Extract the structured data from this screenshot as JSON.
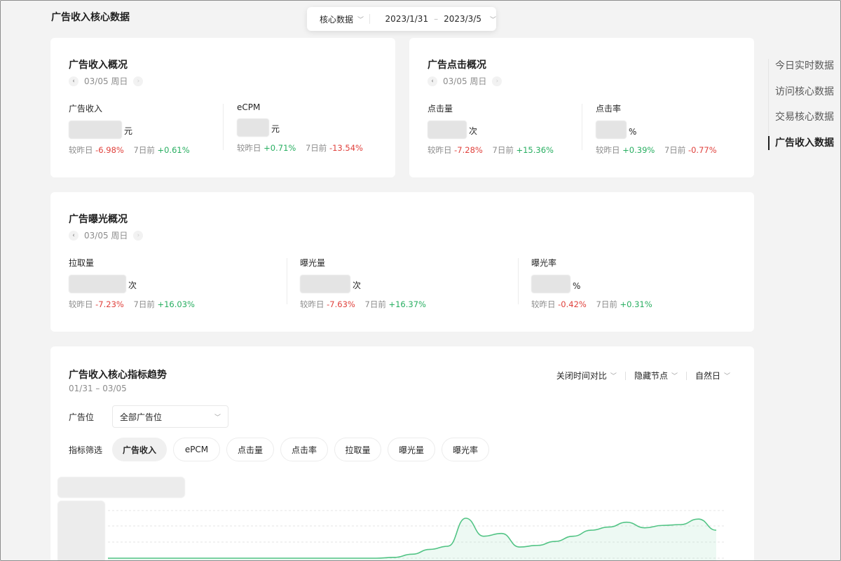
{
  "page_title": "广告收入核心数据",
  "filter_bar": {
    "scope": "核心数据",
    "date_start": "2023/1/31",
    "date_sep": "–",
    "date_end": "2023/3/5"
  },
  "side_nav": {
    "items": [
      {
        "label": "今日实时数据",
        "active": false
      },
      {
        "label": "访问核心数据",
        "active": false
      },
      {
        "label": "交易核心数据",
        "active": false
      },
      {
        "label": "广告收入数据",
        "active": true
      }
    ]
  },
  "revenue_card": {
    "title": "广告收入概况",
    "date": "03/05 周日",
    "metrics": [
      {
        "label": "广告收入",
        "unit": "元",
        "cmp_day_label": "较昨日",
        "cmp_day": "-6.98%",
        "cmp_week_label": "7日前",
        "cmp_week": "+0.61%"
      },
      {
        "label": "eCPM",
        "unit": "元",
        "cmp_day_label": "较昨日",
        "cmp_day": "+0.71%",
        "cmp_week_label": "7日前",
        "cmp_week": "-13.54%"
      }
    ]
  },
  "click_card": {
    "title": "广告点击概况",
    "date": "03/05 周日",
    "metrics": [
      {
        "label": "点击量",
        "unit": "次",
        "cmp_day_label": "较昨日",
        "cmp_day": "-7.28%",
        "cmp_week_label": "7日前",
        "cmp_week": "+15.36%"
      },
      {
        "label": "点击率",
        "unit": "%",
        "cmp_day_label": "较昨日",
        "cmp_day": "+0.39%",
        "cmp_week_label": "7日前",
        "cmp_week": "-0.77%"
      }
    ]
  },
  "exposure_card": {
    "title": "广告曝光概况",
    "date": "03/05 周日",
    "metrics": [
      {
        "label": "拉取量",
        "unit": "次",
        "cmp_day_label": "较昨日",
        "cmp_day": "-7.23%",
        "cmp_week_label": "7日前",
        "cmp_week": "+16.03%"
      },
      {
        "label": "曝光量",
        "unit": "次",
        "cmp_day_label": "较昨日",
        "cmp_day": "-7.63%",
        "cmp_week_label": "7日前",
        "cmp_week": "+16.37%"
      },
      {
        "label": "曝光率",
        "unit": "%",
        "cmp_day_label": "较昨日",
        "cmp_day": "-0.42%",
        "cmp_week_label": "7日前",
        "cmp_week": "+0.31%"
      }
    ]
  },
  "trend_card": {
    "title": "广告收入核心指标趋势",
    "date_range": "01/31 – 03/05",
    "controls": [
      "关闭时间对比",
      "隐藏节点",
      "自然日"
    ],
    "slot_label": "广告位",
    "slot_value": "全部广告位",
    "filter_label": "指标筛选",
    "chips": [
      "广告收入",
      "ePCM",
      "点击量",
      "点击率",
      "拉取量",
      "曝光量",
      "曝光率"
    ],
    "active_chip": "广告收入"
  },
  "colors": {
    "accent": "#27ae60",
    "negative": "#e0413c",
    "positive": "#27ae60",
    "line": "#52c485"
  },
  "chart_data": {
    "type": "area",
    "values": [
      0,
      0,
      0,
      0,
      0,
      0,
      0,
      0,
      0,
      0,
      0,
      0,
      0,
      0,
      0,
      0,
      0.02,
      0.1,
      0.22,
      0.3,
      1.0,
      0.55,
      0.62,
      0.28,
      0.32,
      0.42,
      0.55,
      0.7,
      0.78,
      0.9,
      0.76,
      0.82,
      0.84,
      0.98,
      0.7
    ],
    "grid": true
  }
}
